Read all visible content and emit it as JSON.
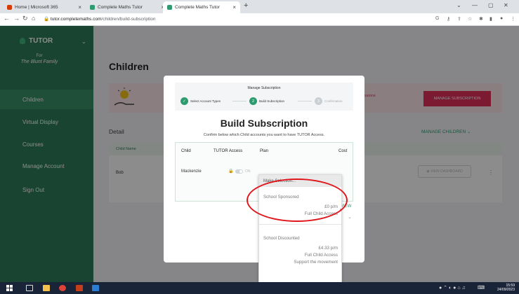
{
  "browser": {
    "tabs": [
      {
        "label": "Home | Microsoft 365",
        "favicon_color": "#d83b01",
        "active": false
      },
      {
        "label": "Complete Maths Tutor",
        "favicon_color": "#2e9b6f",
        "active": false
      },
      {
        "label": "Complete Maths Tutor",
        "favicon_color": "#2e9b6f",
        "active": true
      }
    ],
    "new_tab": "+",
    "url_host": "tutor.completemaths.com",
    "url_path": "/children/build-subscription"
  },
  "sidebar": {
    "logo": "TUTOR",
    "for_label": "For",
    "family": "The Blunt Family",
    "items": [
      {
        "label": "Children",
        "active": true
      },
      {
        "label": "Virtual Display",
        "active": false
      },
      {
        "label": "Courses",
        "active": false
      },
      {
        "label": "Manage Account",
        "active": false
      },
      {
        "label": "Sign Out",
        "active": false
      }
    ]
  },
  "page": {
    "title": "Children",
    "banner_text": "ssions",
    "manage_subscription": "MANAGE SUBSCRIPTION",
    "detail": "Detail",
    "manage_children": "MANAGE CHILDREN",
    "table_header": "Child Name",
    "row_name": "Bob",
    "view_dashboard": "VIEW DASHBOARD"
  },
  "modal": {
    "steps_title": "Manage Subscription",
    "steps": [
      {
        "label": "Select Account Types",
        "marker": "✓",
        "state": "done"
      },
      {
        "label": "Build Subscription",
        "marker": "2",
        "state": "current"
      },
      {
        "label": "Confirmation",
        "marker": "3",
        "state": "pending"
      }
    ],
    "title": "Build Subscription",
    "subtitle": "Confirm below which Child accounts you want to have TUTOR Access.",
    "columns": {
      "child": "Child",
      "access": "TUTOR Access",
      "plan": "Plan",
      "cost": "Cost"
    },
    "row": {
      "child": "Mackenzie",
      "toggle": "ON"
    },
    "view_link": "VIEW"
  },
  "dropdown": {
    "placeholder": "Make Selection...",
    "options": [
      {
        "name": "School Sponsored",
        "price": "£0 p/m",
        "access": "Full Child Access",
        "extra": ""
      },
      {
        "name": "School Discounted",
        "price": "£4.33 p/m",
        "access": "Full Child Access",
        "extra": "Support the movement"
      }
    ],
    "highlighted_option": "School Sponsored",
    "callout_color": "#e0161c"
  },
  "taskbar": {
    "time": "15:59",
    "date": "24/09/2023"
  },
  "colors": {
    "sidebar": "#2e7d5b",
    "accent": "#2e9b6f",
    "primary_button": "#e0305a",
    "taskbar": "#1a2438"
  }
}
